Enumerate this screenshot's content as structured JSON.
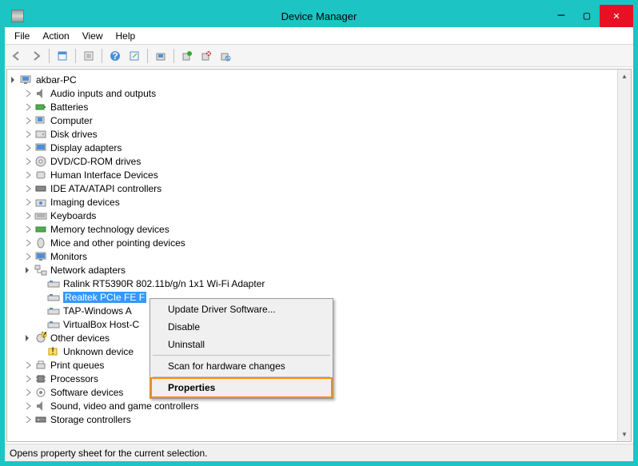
{
  "titlebar": {
    "title": "Device Manager"
  },
  "menubar": {
    "file": "File",
    "action": "Action",
    "view": "View",
    "help": "Help"
  },
  "tree": {
    "root": "akbar-PC",
    "items": [
      "Audio inputs and outputs",
      "Batteries",
      "Computer",
      "Disk drives",
      "Display adapters",
      "DVD/CD-ROM drives",
      "Human Interface Devices",
      "IDE ATA/ATAPI controllers",
      "Imaging devices",
      "Keyboards",
      "Memory technology devices",
      "Mice and other pointing devices",
      "Monitors"
    ],
    "network": {
      "label": "Network adapters",
      "children": [
        "Ralink RT5390R 802.11b/g/n 1x1 Wi-Fi Adapter",
        "Realtek PCIe FE F",
        "TAP-Windows A",
        "VirtualBox Host-C"
      ]
    },
    "other": {
      "label": "Other devices",
      "children": [
        "Unknown device"
      ]
    },
    "rest": [
      "Print queues",
      "Processors",
      "Software devices",
      "Sound, video and game controllers",
      "Storage controllers"
    ]
  },
  "context_menu": {
    "update": "Update Driver Software...",
    "disable": "Disable",
    "uninstall": "Uninstall",
    "scan": "Scan for hardware changes",
    "properties": "Properties"
  },
  "statusbar": {
    "text": "Opens property sheet for the current selection."
  }
}
